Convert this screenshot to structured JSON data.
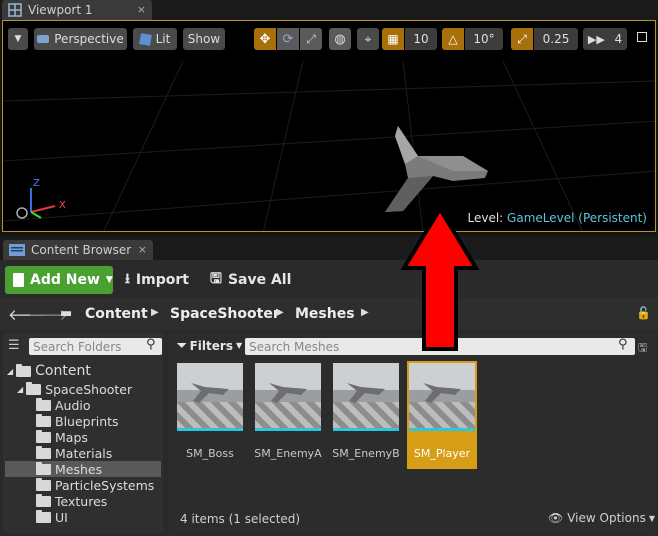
{
  "viewport": {
    "tab_title": "Viewport 1",
    "perspective_label": "Perspective",
    "lit_label": "Lit",
    "show_label": "Show",
    "grid_snap_value": "10",
    "rotation_snap_value": "10°",
    "scale_snap_value": "0.25",
    "camera_speed_value": "4",
    "level_prefix": "Level:",
    "level_name": "GameLevel (Persistent)",
    "axis_labels": {
      "z": "Z",
      "x": "X"
    }
  },
  "content_browser": {
    "tab_title": "Content Browser",
    "add_new_label": "Add New",
    "import_label": "Import",
    "save_all_label": "Save All",
    "breadcrumb": [
      "Content",
      "SpaceShooter",
      "Meshes"
    ],
    "search_folders_placeholder": "Search Folders",
    "filters_label": "Filters",
    "search_assets_placeholder": "Search Meshes",
    "tree": {
      "root": "Content",
      "project": "SpaceShooter",
      "folders": [
        "Audio",
        "Blueprints",
        "Maps",
        "Materials",
        "Meshes",
        "ParticleSystems",
        "Textures",
        "UI"
      ],
      "selected": "Meshes"
    },
    "assets": [
      {
        "name": "SM_Boss",
        "selected": false
      },
      {
        "name": "SM_EnemyA",
        "selected": false
      },
      {
        "name": "SM_EnemyB",
        "selected": false
      },
      {
        "name": "SM_Player",
        "selected": true
      }
    ],
    "status_text": "4 items (1 selected)",
    "view_options_label": "View Options"
  },
  "colors": {
    "add_new_green": "#4aa031",
    "selection_orange": "#d69e16",
    "annotation_arrow": "#ff0000",
    "level_name_blue": "#5fc3e0"
  }
}
